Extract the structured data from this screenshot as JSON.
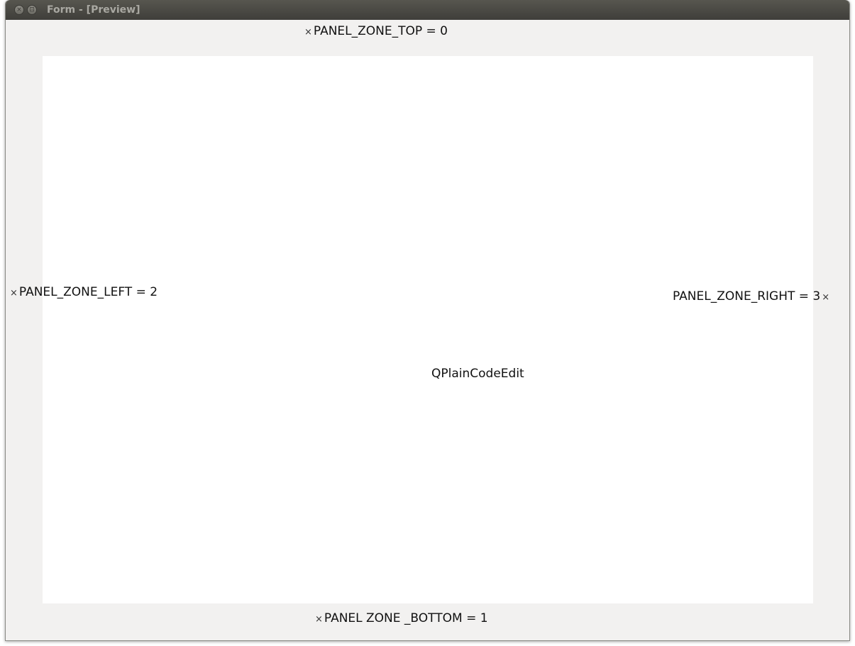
{
  "window": {
    "title": "Form - [Preview]",
    "close_glyph": "×",
    "maximize_glyph": "⊡"
  },
  "panels": {
    "top": {
      "label": "PANEL_ZONE_TOP = 0",
      "icon": "close-icon"
    },
    "left": {
      "label": "PANEL_ZONE_LEFT = 2",
      "icon": "close-icon"
    },
    "right": {
      "label": "PANEL_ZONE_RIGHT = 3",
      "icon": "close-icon"
    },
    "bottom": {
      "label": "PANEL ZONE _BOTTOM = 1",
      "icon": "close-icon"
    }
  },
  "editor": {
    "label": "QPlainCodeEdit"
  },
  "colors": {
    "window_bg": "#f2f1f0",
    "titlebar": "#4c4b46",
    "editor_bg": "#ffffff",
    "text": "#111111"
  }
}
